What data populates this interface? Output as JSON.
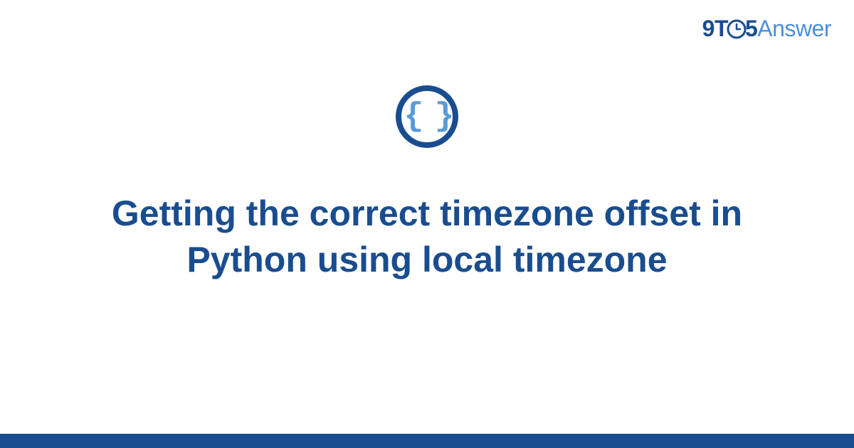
{
  "logo": {
    "part_9": "9",
    "part_t": "T",
    "part_5": "5",
    "part_answer": "Answer"
  },
  "icon": {
    "braces": "{ }"
  },
  "title": "Getting the correct timezone offset in Python using local timezone",
  "colors": {
    "primary": "#1a4d8f",
    "secondary": "#4a90d9",
    "braces": "#5a9bd8"
  }
}
